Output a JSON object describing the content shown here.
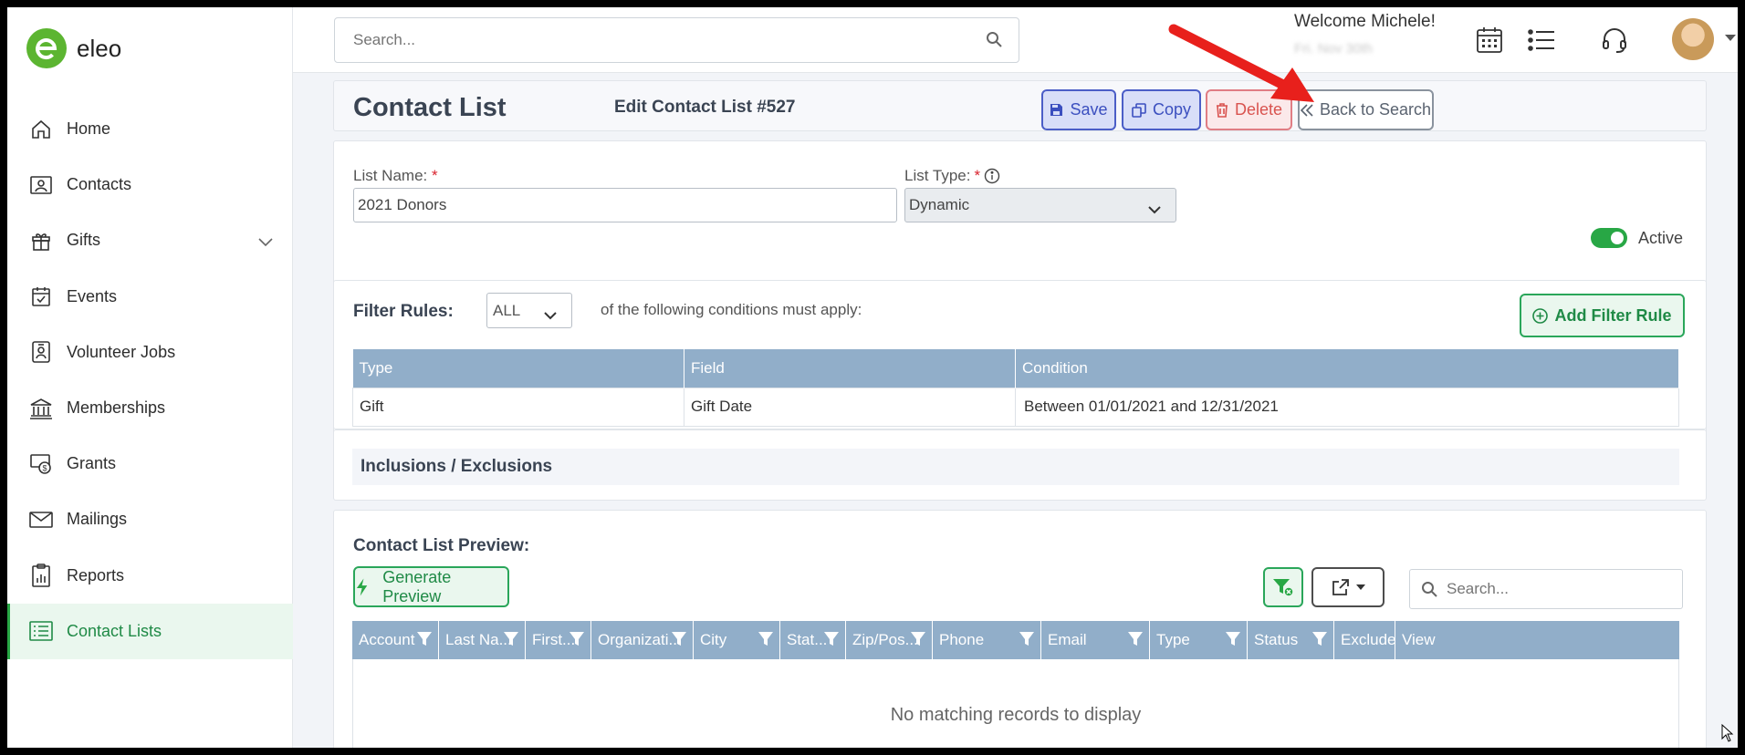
{
  "app": {
    "logo_text": "eleo",
    "brand_color": "#5cb531",
    "accent_color": "#28a745"
  },
  "sidebar": {
    "items": [
      {
        "label": "Home",
        "icon": "home-icon"
      },
      {
        "label": "Contacts",
        "icon": "contacts-icon"
      },
      {
        "label": "Gifts",
        "icon": "gift-icon"
      },
      {
        "label": "Events",
        "icon": "calendar-check-icon"
      },
      {
        "label": "Volunteer Jobs",
        "icon": "badge-icon"
      },
      {
        "label": "Memberships",
        "icon": "bank-icon"
      },
      {
        "label": "Grants",
        "icon": "money-icon"
      },
      {
        "label": "Mailings",
        "icon": "envelope-icon"
      },
      {
        "label": "Reports",
        "icon": "clipboard-chart-icon"
      },
      {
        "label": "Contact Lists",
        "icon": "list-icon"
      }
    ],
    "active": "Contact Lists"
  },
  "topbar": {
    "search_placeholder": "Search...",
    "welcome": "Welcome Michele!",
    "welcome_sub": "Fri. Nov 30th"
  },
  "page": {
    "title": "Contact List",
    "subtitle": "Edit Contact List #527",
    "buttons": {
      "save": "Save",
      "copy": "Copy",
      "delete": "Delete",
      "back": "Back to Search"
    }
  },
  "form": {
    "list_name_label": "List Name:",
    "list_name_value": "2021 Donors",
    "list_type_label": "List Type:",
    "list_type_value": "Dynamic",
    "active_label": "Active",
    "active_on": true,
    "required_mark": "*"
  },
  "filter": {
    "label": "Filter Rules:",
    "match_value": "ALL",
    "condition_text": "of the following conditions must apply:",
    "add_button": "Add Filter Rule",
    "columns": [
      "Type",
      "Field",
      "Condition"
    ],
    "rows": [
      [
        "Gift",
        "Gift Date",
        "Between 01/01/2021 and 12/31/2021"
      ]
    ]
  },
  "inclusions": {
    "title": "Inclusions / Exclusions"
  },
  "preview": {
    "title": "Contact List Preview:",
    "generate_button": "Generate Preview",
    "search_placeholder": "Search...",
    "columns": [
      "Account",
      "Last Na...",
      "First...",
      "Organizati...",
      "City",
      "Stat...",
      "Zip/Pos...",
      "Phone",
      "Email",
      "Type",
      "Status",
      "Exclude",
      "View"
    ],
    "empty_text": "No matching records to display"
  }
}
